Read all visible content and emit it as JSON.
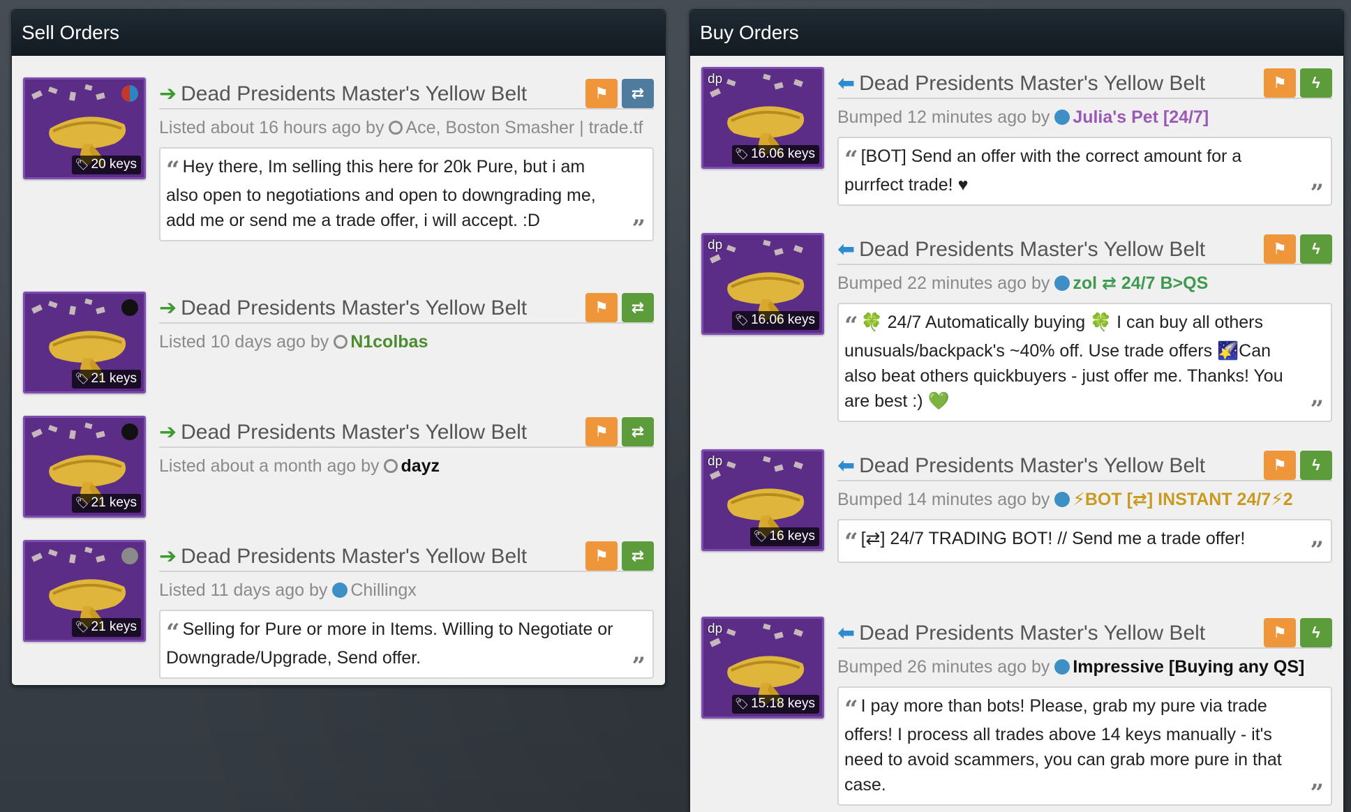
{
  "sell": {
    "header": "Sell Orders",
    "listings": [
      {
        "title": "Dead Presidents Master's Yellow Belt",
        "price": "20 keys",
        "meta_prefix": "Listed about 16 hours ago by",
        "user": "Ace, Boston Smasher | trade.tf",
        "message": "Hey there, Im selling this here for 20k Pure, but i am also open to negotiations and open to downgrading me, add me or send me a trade offer, i will accept. :D",
        "dot_color": "#c0392b",
        "swap_color": "#4f7c9e"
      },
      {
        "title": "Dead Presidents Master's Yellow Belt",
        "price": "21 keys",
        "meta_prefix": "Listed 10 days ago by",
        "user": "N1colbas",
        "message": "",
        "dot_color": "#111111",
        "swap_color": "#5c9c3a"
      },
      {
        "title": "Dead Presidents Master's Yellow Belt",
        "price": "21 keys",
        "meta_prefix": "Listed about a month ago by",
        "user": "dayz",
        "message": "",
        "dot_color": "#111111",
        "swap_color": "#5c9c3a"
      },
      {
        "title": "Dead Presidents Master's Yellow Belt",
        "price": "21 keys",
        "meta_prefix": "Listed 11 days ago by",
        "user": "Chillingx",
        "message": "Selling for Pure or more in Items. Willing to Negotiate or Downgrade/Upgrade, Send offer.",
        "dot_color": "#8a8a8a",
        "swap_color": "#5c9c3a"
      }
    ]
  },
  "buy": {
    "header": "Buy Orders",
    "listings": [
      {
        "title": "Dead Presidents Master's Yellow Belt",
        "price": "16.06 keys",
        "badge": "dp",
        "meta_prefix": "Bumped 12 minutes ago by",
        "user": "Julia's Pet [24/7]",
        "message": "[BOT] Send an offer with the correct amount for a purrfect trade! ♥"
      },
      {
        "title": "Dead Presidents Master's Yellow Belt",
        "price": "16.06 keys",
        "badge": "dp",
        "meta_prefix": "Bumped 22 minutes ago by",
        "user": "zol ⇄ 24/7 B>QS",
        "message": "🍀 24/7 Automatically buying 🍀 I can buy all others unusuals/backpack's ~40% off. Use trade offers 🌠Can also beat others quickbuyers - just offer me. Thanks! You are best :) 💚"
      },
      {
        "title": "Dead Presidents Master's Yellow Belt",
        "price": "16 keys",
        "badge": "dp",
        "meta_prefix": "Bumped 14 minutes ago by",
        "user": "⚡BOT [⇄] INSTANT 24/7⚡2",
        "message": "[⇄] 24/7 TRADING BOT! // Send me a trade offer!"
      },
      {
        "title": "Dead Presidents Master's Yellow Belt",
        "price": "15.18 keys",
        "badge": "dp",
        "meta_prefix": "Bumped 26 minutes ago by",
        "user": "Impressive [Buying any QS]",
        "message": "I pay more than bots! Please, grab my pure via trade offers! I process all trades above 14 keys manually - it's need to avoid scammers, you can grab more pure in that case."
      }
    ]
  },
  "colors": {
    "flag_button": "#f0963a",
    "green_button": "#5c9c3a",
    "sell_arrow": "#3c9a2e",
    "buy_arrow": "#2d8ccf",
    "item_background": "#5b2d87"
  },
  "icons": {
    "sell_arrow": "arrow-right-icon",
    "buy_arrow": "arrow-left-icon",
    "flag": "flag-icon",
    "swap": "swap-icon",
    "bolt": "lightning-icon",
    "tag": "tag-icon",
    "quote": "quote-icon"
  }
}
